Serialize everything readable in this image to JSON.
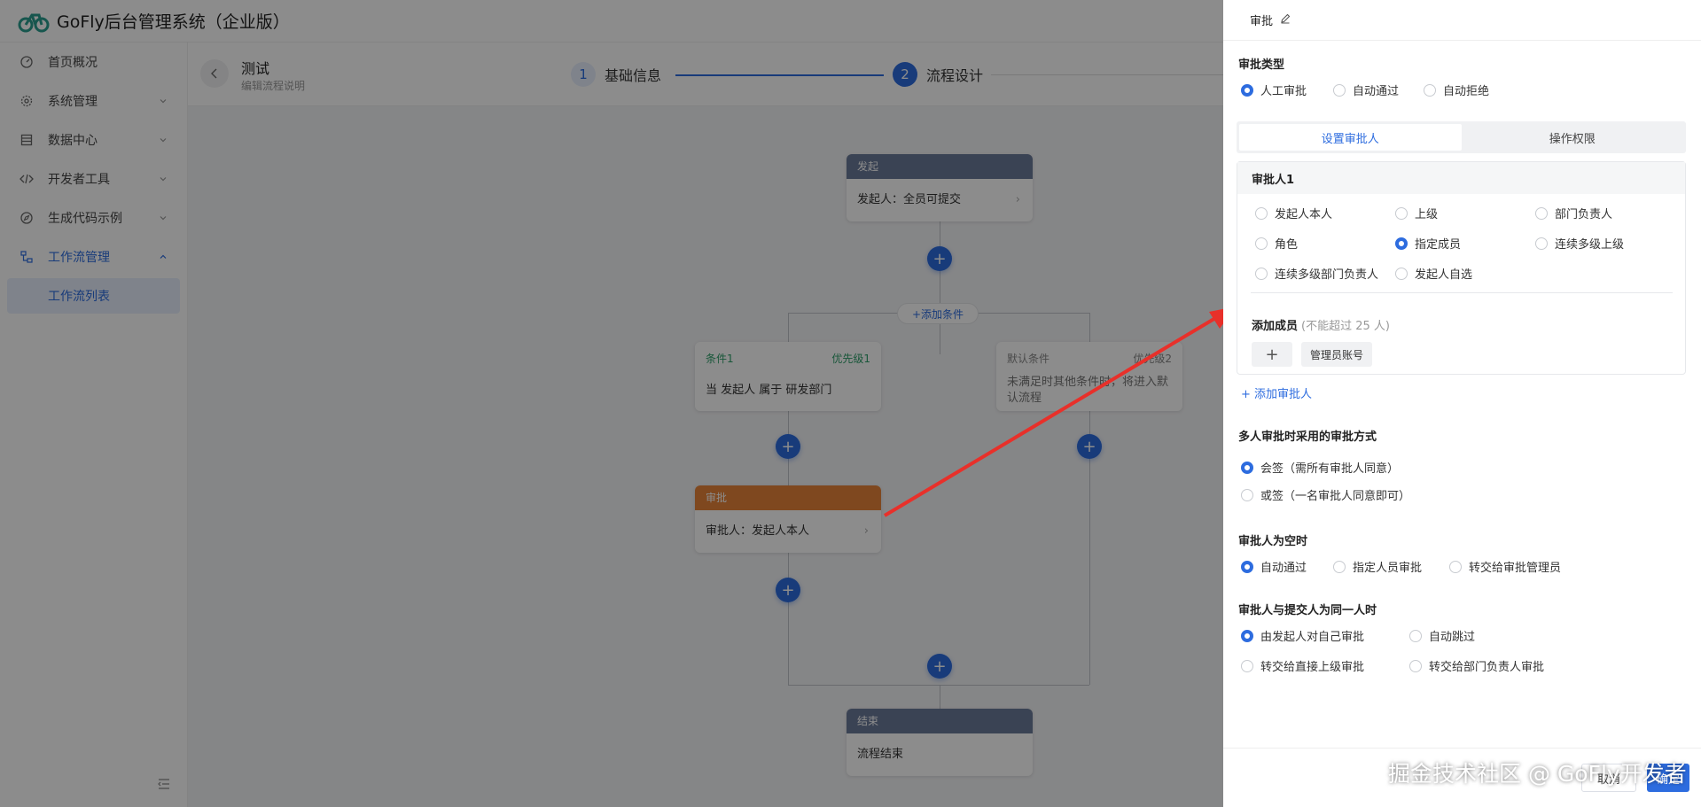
{
  "app": {
    "title": "GoFly后台管理系统（企业版）"
  },
  "sidebar": {
    "items": [
      {
        "label": "首页概况",
        "icon": "dashboard-icon"
      },
      {
        "label": "系统管理",
        "icon": "gear-icon"
      },
      {
        "label": "数据中心",
        "icon": "table-icon"
      },
      {
        "label": "开发者工具",
        "icon": "code-icon"
      },
      {
        "label": "生成代码示例",
        "icon": "compass-icon"
      },
      {
        "label": "工作流管理",
        "icon": "workflow-icon"
      }
    ],
    "sub_active": "工作流列表"
  },
  "topbar": {
    "workflow_name": "测试",
    "workflow_desc": "编辑流程说明",
    "steps": [
      {
        "num": "1",
        "label": "基础信息"
      },
      {
        "num": "2",
        "label": "流程设计"
      }
    ]
  },
  "flow": {
    "start": {
      "head": "发起",
      "body": "发起人：全员可提交"
    },
    "add_condition": "+添加条件",
    "cond1": {
      "title": "条件1",
      "priority": "优先级1",
      "body": "当 发起人 属于 研发部门"
    },
    "cond_default": {
      "title": "默认条件",
      "priority": "优先级2",
      "body": "未满足时其他条件时，将进入默认流程"
    },
    "approve": {
      "head": "审批",
      "body": "审批人：发起人本人"
    },
    "end": {
      "head": "结束",
      "body": "流程结束"
    },
    "colors": {
      "start": "#6b7a99",
      "approve": "#e8843a",
      "end": "#6b7a99",
      "plus": "#2d6cdf"
    }
  },
  "drawer": {
    "title": "审批",
    "approval_type": {
      "title": "审批类型",
      "options": [
        "人工审批",
        "自动通过",
        "自动拒绝"
      ],
      "selected": "人工审批"
    },
    "tabs": [
      "设置审批人",
      "操作权限"
    ],
    "approver": {
      "title": "审批人1",
      "options": [
        "发起人本人",
        "上级",
        "部门负责人",
        "角色",
        "指定成员",
        "连续多级上级",
        "连续多级部门负责人",
        "发起人自选"
      ],
      "selected": "指定成员",
      "add_member_label": "添加成员",
      "add_member_hint": "(不能超过 25 人)",
      "member": "管理员账号"
    },
    "add_approver": "+ 添加审批人",
    "multi_mode": {
      "title": "多人审批时采用的审批方式",
      "options": [
        "会签（需所有审批人同意）",
        "或签（一名审批人同意即可）"
      ],
      "selected": "会签（需所有审批人同意）"
    },
    "empty": {
      "title": "审批人为空时",
      "options": [
        "自动通过",
        "指定人员审批",
        "转交给审批管理员"
      ],
      "selected": "自动通过"
    },
    "same_person": {
      "title": "审批人与提交人为同一人时",
      "options": [
        "由发起人对自己审批",
        "自动跳过",
        "转交给直接上级审批",
        "转交给部门负责人审批"
      ],
      "selected": "由发起人对自己审批"
    },
    "cancel": "取消",
    "ok": "确定"
  },
  "watermark": "掘金技术社区 @ GoFly开发者"
}
